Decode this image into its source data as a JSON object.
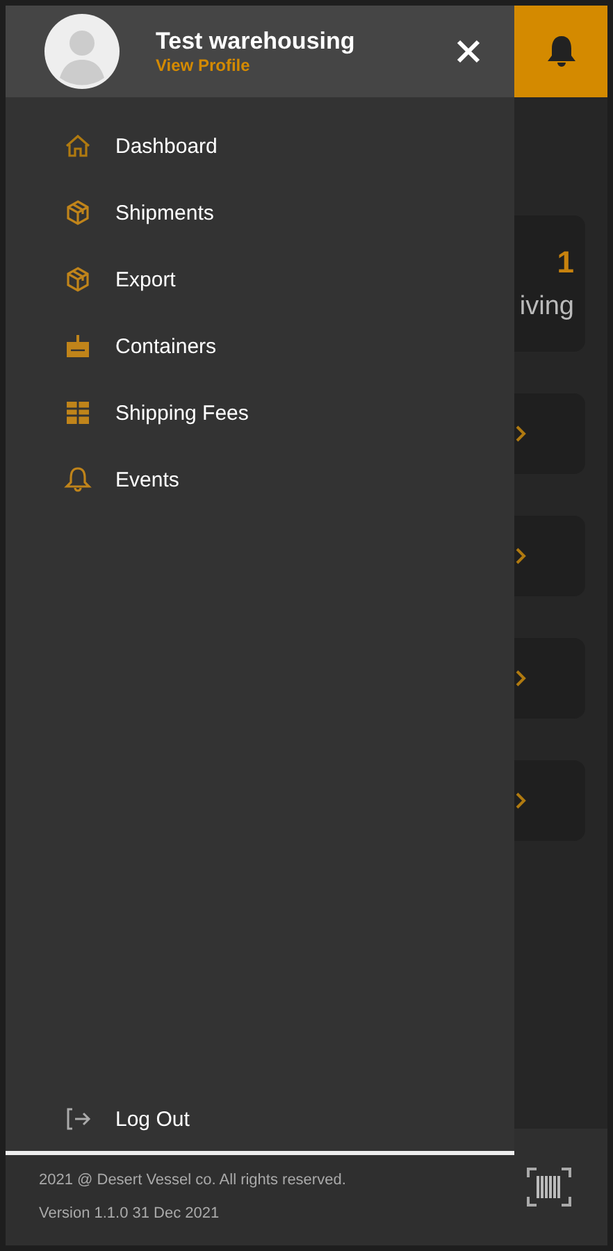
{
  "background": {
    "cards": [
      {
        "kind": "stat",
        "value": "1",
        "label": "iving"
      },
      {
        "kind": "link"
      },
      {
        "kind": "link"
      },
      {
        "kind": "link"
      },
      {
        "kind": "link"
      }
    ]
  },
  "drawer": {
    "profile": {
      "name": "Test warehousing",
      "link": "View Profile"
    },
    "menu": [
      {
        "label": "Dashboard",
        "kind": "home"
      },
      {
        "label": "Shipments",
        "kind": "box"
      },
      {
        "label": "Export",
        "kind": "box"
      },
      {
        "label": "Containers",
        "kind": "container"
      },
      {
        "label": "Shipping Fees",
        "kind": "fees"
      },
      {
        "label": "Events",
        "kind": "bell"
      }
    ],
    "logout": "Log Out"
  },
  "footer": {
    "copyright": "2021 @ Desert Vessel co. All rights reserved.",
    "version": "Version 1.1.0 31 Dec 2021"
  }
}
